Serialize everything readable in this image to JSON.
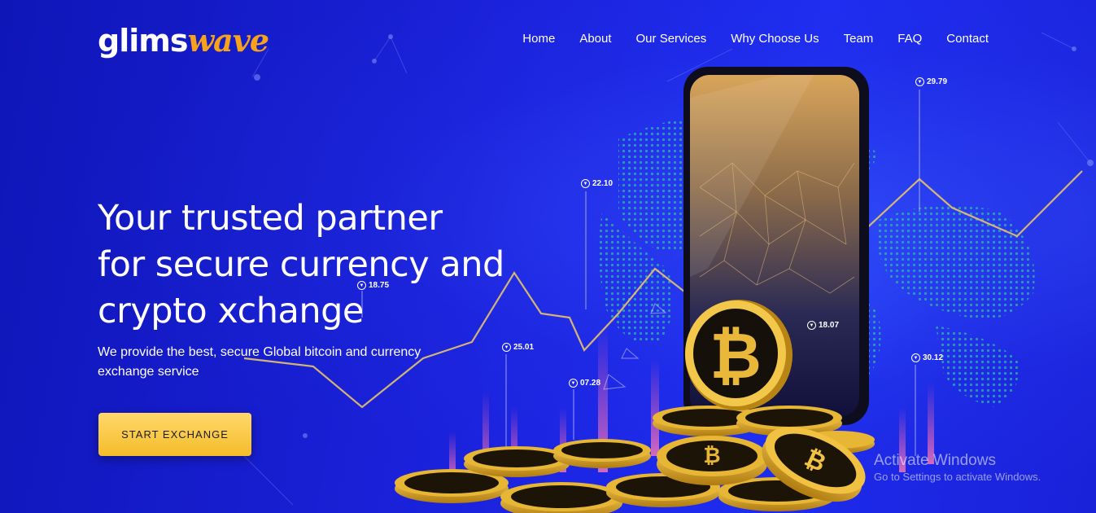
{
  "brand": {
    "logo_part1": "glims",
    "logo_part2": "wave"
  },
  "nav": {
    "items": [
      "Home",
      "About",
      "Our Services",
      "Why Choose Us",
      "Team",
      "FAQ",
      "Contact"
    ]
  },
  "hero": {
    "headline_line1": "Your trusted partner",
    "headline_line2": "for secure currency and",
    "headline_line3": "crypto xchange",
    "subtext": "We provide the best, secure Global bitcoin and currency exchange service",
    "cta_label": "START EXCHANGE"
  },
  "price_tags": [
    "29.79",
    "22.10",
    "18.75",
    "25.01",
    "07.28",
    "18.07",
    "30.12"
  ],
  "watermark": {
    "title": "Activate Windows",
    "subtitle": "Go to Settings to activate Windows."
  },
  "colors": {
    "background": "#1a1fd6",
    "accent": "#f6a21a",
    "cta": "#f4bc2a",
    "text": "#ffffff"
  },
  "icons": [
    "bitcoin-icon",
    "price-marker-icon",
    "smartphone-icon"
  ]
}
